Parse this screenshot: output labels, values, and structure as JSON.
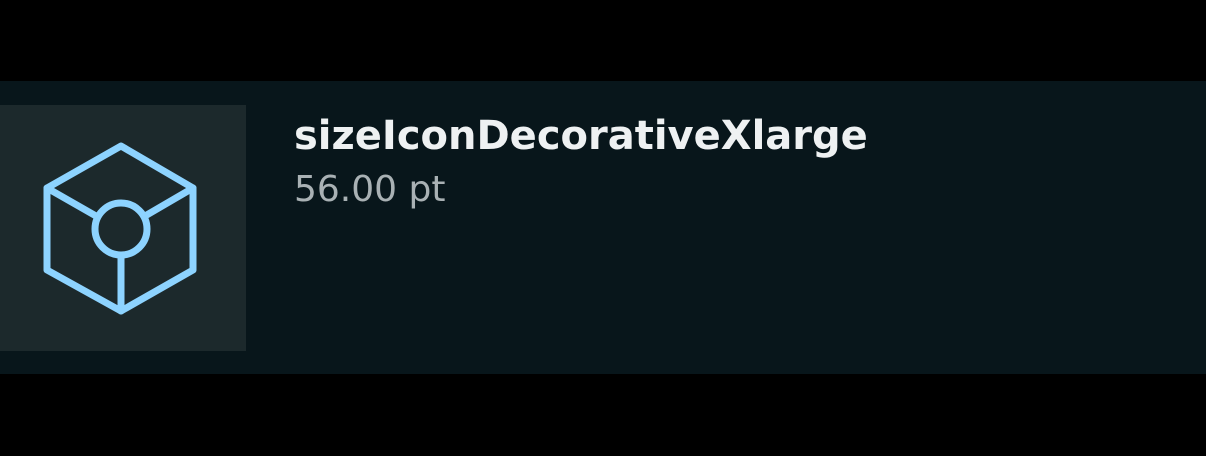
{
  "token": {
    "name": "sizeIconDecorativeXlarge",
    "value": "56.00 pt",
    "icon": "cube-icon",
    "icon_color": "#8dd3ff",
    "preview_background": "#1c292c",
    "row_background": "#08161b"
  }
}
